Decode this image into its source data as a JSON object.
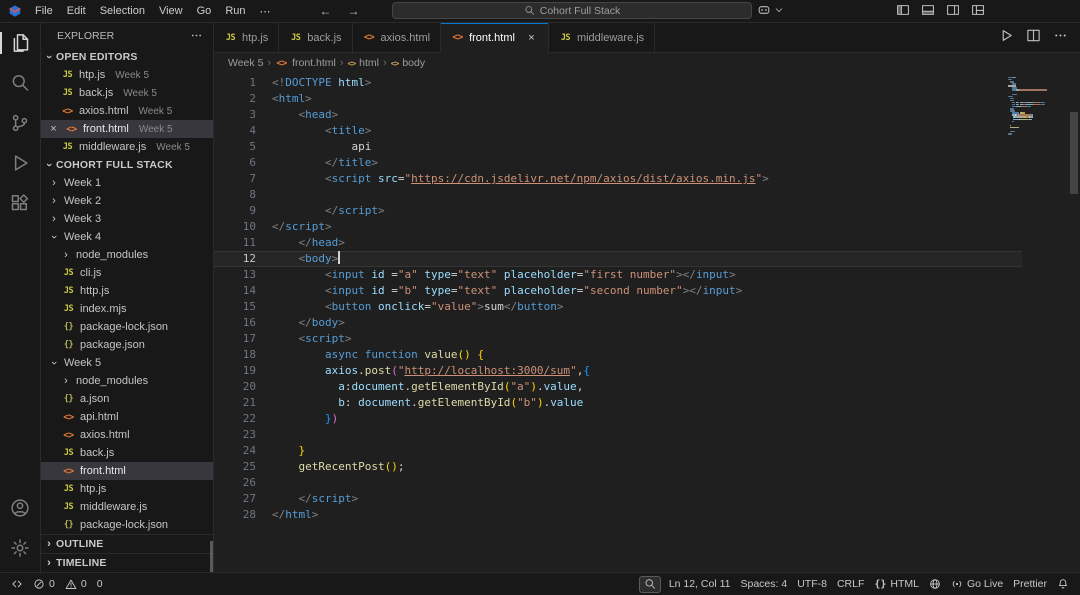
{
  "app": {
    "search_text": "Cohort Full Stack"
  },
  "menus": [
    "File",
    "Edit",
    "Selection",
    "View",
    "Go",
    "Run",
    "⋯"
  ],
  "titlebar_right_icons": [
    {
      "name": "toggle-primary-sidebar",
      "icon": "layout-sidebar-icon"
    },
    {
      "name": "toggle-panel",
      "icon": "layout-panel-icon"
    },
    {
      "name": "toggle-secondary-sidebar",
      "icon": "layout-secondary-sidebar-icon"
    },
    {
      "name": "customize-layout",
      "icon": "customize-layout-icon"
    }
  ],
  "activity_bar": {
    "top": [
      {
        "name": "explorer",
        "icon": "files-icon",
        "active": true
      },
      {
        "name": "search",
        "icon": "search-icon"
      },
      {
        "name": "source-control",
        "icon": "source-control-icon"
      },
      {
        "name": "run-and-debug",
        "icon": "run-debug-icon"
      },
      {
        "name": "extensions",
        "icon": "extensions-icon"
      }
    ],
    "bottom": [
      {
        "name": "accounts",
        "icon": "account-icon"
      },
      {
        "name": "settings",
        "icon": "settings-gear-icon"
      }
    ]
  },
  "sidebar": {
    "title": "EXPLORER",
    "open_editors_label": "OPEN EDITORS",
    "open_editors": [
      {
        "icon": "js",
        "label": "htp.js",
        "desc": "Week 5"
      },
      {
        "icon": "js",
        "label": "back.js",
        "desc": "Week 5"
      },
      {
        "icon": "html",
        "label": "axios.html",
        "desc": "Week 5"
      },
      {
        "icon": "html",
        "label": "front.html",
        "desc": "Week 5",
        "active": true
      },
      {
        "icon": "js",
        "label": "middleware.js",
        "desc": "Week 5"
      }
    ],
    "workspace_label": "COHORT FULL STACK",
    "tree": [
      {
        "depth": 0,
        "chevron": "right",
        "label": "Week 1"
      },
      {
        "depth": 0,
        "chevron": "right",
        "label": "Week 2"
      },
      {
        "depth": 0,
        "chevron": "right",
        "label": "Week 3"
      },
      {
        "depth": 0,
        "chevron": "down",
        "label": "Week 4"
      },
      {
        "depth": 1,
        "chevron": "right",
        "label": "node_modules"
      },
      {
        "depth": 1,
        "icon": "js",
        "label": "cli.js"
      },
      {
        "depth": 1,
        "icon": "js",
        "label": "http.js"
      },
      {
        "depth": 1,
        "icon": "js",
        "label": "index.mjs"
      },
      {
        "depth": 1,
        "icon": "json",
        "label": "package-lock.json"
      },
      {
        "depth": 1,
        "icon": "json",
        "label": "package.json"
      },
      {
        "depth": 0,
        "chevron": "down",
        "label": "Week 5"
      },
      {
        "depth": 1,
        "chevron": "right",
        "label": "node_modules"
      },
      {
        "depth": 1,
        "icon": "json",
        "label": "a.json"
      },
      {
        "depth": 1,
        "icon": "html",
        "label": "api.html"
      },
      {
        "depth": 1,
        "icon": "html",
        "label": "axios.html"
      },
      {
        "depth": 1,
        "icon": "js",
        "label": "back.js"
      },
      {
        "depth": 1,
        "icon": "html",
        "label": "front.html",
        "selected": true
      },
      {
        "depth": 1,
        "icon": "js",
        "label": "htp.js"
      },
      {
        "depth": 1,
        "icon": "js",
        "label": "middleware.js"
      },
      {
        "depth": 1,
        "icon": "json",
        "label": "package-lock.json"
      }
    ],
    "outline_label": "OUTLINE",
    "timeline_label": "TIMELINE"
  },
  "tabs": [
    {
      "icon": "js",
      "label": "htp.js"
    },
    {
      "icon": "js",
      "label": "back.js"
    },
    {
      "icon": "html",
      "label": "axios.html"
    },
    {
      "icon": "html",
      "label": "front.html",
      "active": true
    },
    {
      "icon": "js",
      "label": "middleware.js"
    }
  ],
  "editor_actions": [
    {
      "name": "run-file",
      "icon": "run-icon"
    },
    {
      "name": "split-editor",
      "icon": "split-editor-icon"
    },
    {
      "name": "more-actions",
      "icon": "more-actions-icon"
    }
  ],
  "breadcrumbs": [
    {
      "label": "Week 5"
    },
    {
      "label": "front.html",
      "icon": "html"
    },
    {
      "label": "html",
      "icon": "symbol"
    },
    {
      "label": "body",
      "icon": "symbol"
    }
  ],
  "code": {
    "current_line": 12,
    "cursor_col": 11,
    "lines": [
      [
        [
          "pun",
          "<!"
        ],
        [
          "tag",
          "DOCTYPE"
        ],
        [
          "atr",
          " html"
        ],
        [
          "pun",
          ">"
        ]
      ],
      [
        [
          "pun",
          "<"
        ],
        [
          "tag",
          "html"
        ],
        [
          "pun",
          ">"
        ]
      ],
      [
        [
          "pln",
          "    "
        ],
        [
          "pun",
          "<"
        ],
        [
          "tag",
          "head"
        ],
        [
          "pun",
          ">"
        ]
      ],
      [
        [
          "pln",
          "        "
        ],
        [
          "pun",
          "<"
        ],
        [
          "tag",
          "title"
        ],
        [
          "pun",
          ">"
        ]
      ],
      [
        [
          "pln",
          "            api"
        ]
      ],
      [
        [
          "pln",
          "        "
        ],
        [
          "pun",
          "</"
        ],
        [
          "tag",
          "title"
        ],
        [
          "pun",
          ">"
        ]
      ],
      [
        [
          "pln",
          "        "
        ],
        [
          "pun",
          "<"
        ],
        [
          "tag",
          "script"
        ],
        [
          "pln",
          " "
        ],
        [
          "atr",
          "src"
        ],
        [
          "op",
          "="
        ],
        [
          "str",
          "\""
        ],
        [
          "lnk",
          "https://cdn.jsdelivr.net/npm/axios/dist/axios.min.js"
        ],
        [
          "str",
          "\""
        ],
        [
          "pun",
          ">"
        ]
      ],
      [],
      [
        [
          "pln",
          "        "
        ],
        [
          "pun",
          "</"
        ],
        [
          "tag",
          "script"
        ],
        [
          "pun",
          ">"
        ]
      ],
      [
        [
          "pun",
          "</"
        ],
        [
          "tag",
          "script"
        ],
        [
          "pun",
          ">"
        ]
      ],
      [
        [
          "pln",
          "    "
        ],
        [
          "pun",
          "</"
        ],
        [
          "tag",
          "head"
        ],
        [
          "pun",
          ">"
        ]
      ],
      [
        [
          "pln",
          "    "
        ],
        [
          "pun",
          "<"
        ],
        [
          "tag",
          "body"
        ],
        [
          "pun",
          ">"
        ]
      ],
      [
        [
          "pln",
          "        "
        ],
        [
          "pun",
          "<"
        ],
        [
          "tag",
          "input"
        ],
        [
          "pln",
          " "
        ],
        [
          "atr",
          "id"
        ],
        [
          "pln",
          " "
        ],
        [
          "op",
          "="
        ],
        [
          "str",
          "\"a\""
        ],
        [
          "pln",
          " "
        ],
        [
          "atr",
          "type"
        ],
        [
          "op",
          "="
        ],
        [
          "str",
          "\"text\""
        ],
        [
          "pln",
          " "
        ],
        [
          "atr",
          "placeholder"
        ],
        [
          "op",
          "="
        ],
        [
          "str",
          "\"first number\""
        ],
        [
          "pun",
          "></"
        ],
        [
          "tag",
          "input"
        ],
        [
          "pun",
          ">"
        ]
      ],
      [
        [
          "pln",
          "        "
        ],
        [
          "pun",
          "<"
        ],
        [
          "tag",
          "input"
        ],
        [
          "pln",
          " "
        ],
        [
          "atr",
          "id"
        ],
        [
          "pln",
          " "
        ],
        [
          "op",
          "="
        ],
        [
          "str",
          "\"b\""
        ],
        [
          "pln",
          " "
        ],
        [
          "atr",
          "type"
        ],
        [
          "op",
          "="
        ],
        [
          "str",
          "\"text\""
        ],
        [
          "pln",
          " "
        ],
        [
          "atr",
          "placeholder"
        ],
        [
          "op",
          "="
        ],
        [
          "str",
          "\"second number\""
        ],
        [
          "pun",
          "></"
        ],
        [
          "tag",
          "input"
        ],
        [
          "pun",
          ">"
        ]
      ],
      [
        [
          "pln",
          "        "
        ],
        [
          "pun",
          "<"
        ],
        [
          "tag",
          "button"
        ],
        [
          "pln",
          " "
        ],
        [
          "atr",
          "onclick"
        ],
        [
          "op",
          "="
        ],
        [
          "str",
          "\"value\""
        ],
        [
          "pun",
          ">"
        ],
        [
          "pln",
          "sum"
        ],
        [
          "pun",
          "</"
        ],
        [
          "tag",
          "button"
        ],
        [
          "pun",
          ">"
        ]
      ],
      [
        [
          "pln",
          "    "
        ],
        [
          "pun",
          "</"
        ],
        [
          "tag",
          "body"
        ],
        [
          "pun",
          ">"
        ]
      ],
      [
        [
          "pln",
          "    "
        ],
        [
          "pun",
          "<"
        ],
        [
          "tag",
          "script"
        ],
        [
          "pun",
          ">"
        ]
      ],
      [
        [
          "pln",
          "        "
        ],
        [
          "kw",
          "async"
        ],
        [
          "pln",
          " "
        ],
        [
          "kw",
          "function"
        ],
        [
          "pln",
          " "
        ],
        [
          "fn",
          "value"
        ],
        [
          "b1",
          "()"
        ],
        [
          "pln",
          " "
        ],
        [
          "b1",
          "{"
        ]
      ],
      [
        [
          "pln",
          "        "
        ],
        [
          "var",
          "axios"
        ],
        [
          "op",
          "."
        ],
        [
          "fn",
          "post"
        ],
        [
          "b2",
          "("
        ],
        [
          "str",
          "\""
        ],
        [
          "lnk",
          "http://localhost:3000/sum"
        ],
        [
          "str",
          "\""
        ],
        [
          "op",
          ","
        ],
        [
          "b3",
          "{"
        ]
      ],
      [
        [
          "pln",
          "          "
        ],
        [
          "var",
          "a"
        ],
        [
          "op",
          ":"
        ],
        [
          "var",
          "document"
        ],
        [
          "op",
          "."
        ],
        [
          "fn",
          "getElementById"
        ],
        [
          "b1",
          "("
        ],
        [
          "str",
          "\"a\""
        ],
        [
          "b1",
          ")"
        ],
        [
          "op",
          "."
        ],
        [
          "var",
          "value"
        ],
        [
          "op",
          ","
        ]
      ],
      [
        [
          "pln",
          "          "
        ],
        [
          "var",
          "b"
        ],
        [
          "op",
          ": "
        ],
        [
          "var",
          "document"
        ],
        [
          "op",
          "."
        ],
        [
          "fn",
          "getElementById"
        ],
        [
          "b1",
          "("
        ],
        [
          "str",
          "\"b\""
        ],
        [
          "b1",
          ")"
        ],
        [
          "op",
          "."
        ],
        [
          "var",
          "value"
        ]
      ],
      [
        [
          "pln",
          "        "
        ],
        [
          "b3",
          "}"
        ],
        [
          "b2",
          ")"
        ]
      ],
      [],
      [
        [
          "pln",
          "    "
        ],
        [
          "b1",
          "}"
        ]
      ],
      [
        [
          "pln",
          "    "
        ],
        [
          "fn",
          "getRecentPost"
        ],
        [
          "b1",
          "()"
        ],
        [
          "op",
          ";"
        ]
      ],
      [],
      [
        [
          "pln",
          "    "
        ],
        [
          "pun",
          "</"
        ],
        [
          "tag",
          "script"
        ],
        [
          "pun",
          ">"
        ]
      ],
      [
        [
          "pun",
          "</"
        ],
        [
          "tag",
          "html"
        ],
        [
          "pun",
          ">"
        ]
      ]
    ]
  },
  "status": {
    "left": [
      {
        "name": "remote",
        "icon": "remote-indicator-icon"
      },
      {
        "name": "errors",
        "icon": "error-icon",
        "label": "0"
      },
      {
        "name": "warnings",
        "icon": "warning-icon",
        "label": "0"
      },
      {
        "name": "counter",
        "label": "0"
      }
    ],
    "right": [
      {
        "name": "zoom",
        "icon": "zoom-icon",
        "boxed": true
      },
      {
        "name": "cursor-position",
        "label": "Ln 12, Col 11"
      },
      {
        "name": "indentation",
        "label": "Spaces: 4"
      },
      {
        "name": "encoding",
        "label": "UTF-8"
      },
      {
        "name": "eol",
        "label": "CRLF"
      },
      {
        "name": "language-mode",
        "icon": "braces-icon",
        "label": "HTML"
      },
      {
        "name": "browser-preview",
        "icon": "browser-icon"
      },
      {
        "name": "go-live",
        "icon": "broadcast-icon",
        "label": "Go Live"
      },
      {
        "name": "prettier",
        "label": "Prettier"
      },
      {
        "name": "notifications",
        "icon": "bell-icon"
      }
    ]
  },
  "colors": {
    "accent": "#0078d4",
    "editor_bg": "#1f1f1f",
    "panel_bg": "#181818",
    "js_icon": "#cbcb41",
    "html_icon": "#e37933",
    "json_icon": "#b8b85a"
  },
  "syntax_colors": {
    "tag": "#569cd6",
    "attr": "#9cdcfe",
    "string": "#ce9178",
    "function": "#dcdcaa",
    "keyword": "#569cd6",
    "variable": "#9cdcfe",
    "punct": "#808080",
    "plain": "#d4d4d4",
    "bracket1": "#ffd700",
    "bracket2": "#da70d6",
    "bracket3": "#179fff"
  }
}
